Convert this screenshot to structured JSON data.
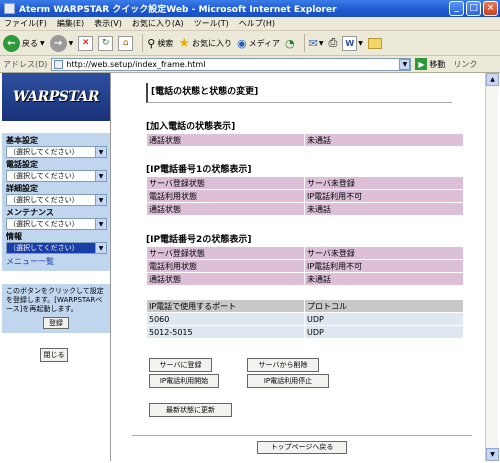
{
  "window": {
    "title": "Aterm WARPSTAR クイック設定Web - Microsoft Internet Explorer",
    "minimize": "_",
    "maximize": "□",
    "close": "×"
  },
  "menubar": [
    "ファイル(F)",
    "編集(E)",
    "表示(V)",
    "お気に入り(A)",
    "ツール(T)",
    "ヘルプ(H)"
  ],
  "toolbar": {
    "back": "戻る",
    "search": "検索",
    "favorites": "お気に入り",
    "media": "メディア"
  },
  "address": {
    "label": "アドレス(D)",
    "url": "http://web.setup/index_frame.html",
    "go": "移動",
    "links": "リンク"
  },
  "sidebar": {
    "logo": "WARPSTAR",
    "groups": [
      {
        "label": "基本設定",
        "selected": "（選択してください）"
      },
      {
        "label": "電話設定",
        "selected": "（選択してください）"
      },
      {
        "label": "詳細設定",
        "selected": "（選択してください）"
      },
      {
        "label": "メンテナンス",
        "selected": "（選択してください）"
      },
      {
        "label": "情報",
        "selected": "（選択してください）"
      }
    ],
    "menu_link": "メニュー一覧",
    "register_note": "このボタンをクリックして設定を登録します。[WARPSTARベース]を再起動します。",
    "register_button": "登録",
    "close_button": "閉じる"
  },
  "main": {
    "title": "[電話の状態と状態の変更]",
    "sections": [
      {
        "heading": "[加入電話の状態表示]",
        "rows": [
          [
            "通話状態",
            "未通話"
          ]
        ]
      },
      {
        "heading": "[IP電話番号1の状態表示]",
        "rows": [
          [
            "サーバ登録状態",
            "サーバ未登録"
          ],
          [
            "電話利用状態",
            "IP電話利用不可"
          ],
          [
            "通話状態",
            "未通話"
          ]
        ]
      },
      {
        "heading": "[IP電話番号2の状態表示]",
        "rows": [
          [
            "サーバ登録状態",
            "サーバ未登録"
          ],
          [
            "電話利用状態",
            "IP電話利用不可"
          ],
          [
            "通話状態",
            "未通話"
          ]
        ]
      }
    ],
    "ports": {
      "header": [
        "IP電話で使用するポート",
        "プロトコル"
      ],
      "rows": [
        [
          "5060",
          "UDP"
        ],
        [
          "5012-5015",
          "UDP"
        ]
      ]
    },
    "buttons": {
      "register_server": "サーバに登録",
      "delete_server": "サーバから削除",
      "ip_start": "IP電話利用開始",
      "ip_stop": "IP電話利用停止",
      "refresh": "最新状態に更新",
      "top_page": "トップページへ戻る"
    }
  }
}
